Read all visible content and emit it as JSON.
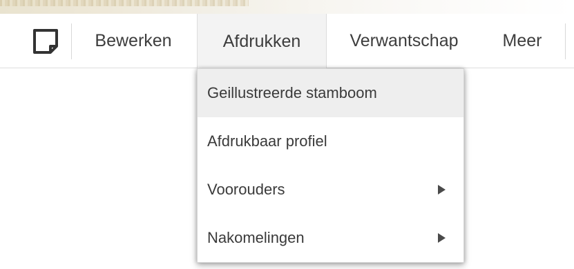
{
  "toolbar": {
    "note_icon": "sticky-note-icon",
    "tabs": [
      {
        "label": "Bewerken",
        "active": false
      },
      {
        "label": "Afdrukken",
        "active": true
      },
      {
        "label": "Verwantschap",
        "active": false
      },
      {
        "label": "Meer",
        "active": false
      }
    ]
  },
  "dropdown": {
    "items": [
      {
        "label": "Geillustreerde stamboom",
        "highlighted": true,
        "submenu": false
      },
      {
        "label": "Afdrukbaar profiel",
        "highlighted": false,
        "submenu": false
      },
      {
        "label": "Voorouders",
        "highlighted": false,
        "submenu": true,
        "submenu_icon": "triangle-right-icon"
      },
      {
        "label": "Nakomelingen",
        "highlighted": false,
        "submenu": true,
        "submenu_icon": "triangle-right-icon"
      }
    ]
  },
  "colors": {
    "active_tab_bg": "#f3f3f3",
    "highlight_bg": "#eeeeee",
    "text": "#3d3d3d"
  }
}
